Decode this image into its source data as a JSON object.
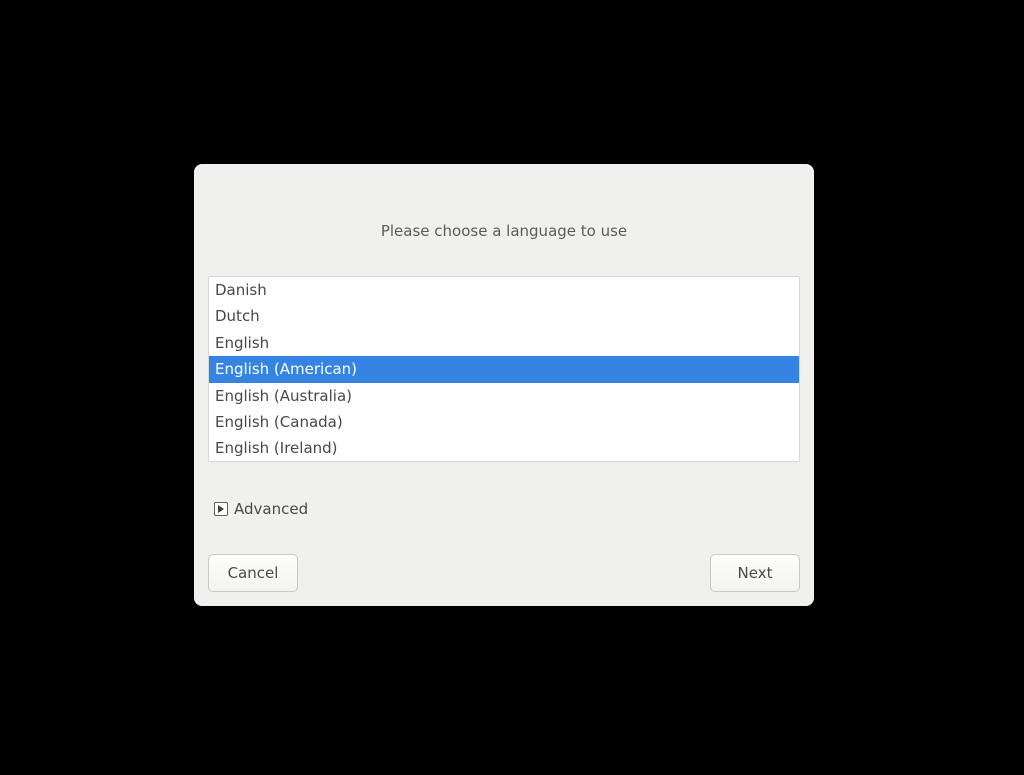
{
  "dialog": {
    "prompt": "Please choose a language to use",
    "languages": [
      {
        "label": "Danish",
        "selected": false
      },
      {
        "label": "Dutch",
        "selected": false
      },
      {
        "label": "English",
        "selected": false
      },
      {
        "label": "English (American)",
        "selected": true
      },
      {
        "label": "English (Australia)",
        "selected": false
      },
      {
        "label": "English (Canada)",
        "selected": false
      },
      {
        "label": "English (Ireland)",
        "selected": false
      }
    ],
    "advanced_label": "Advanced",
    "cancel_label": "Cancel",
    "next_label": "Next"
  },
  "colors": {
    "selection": "#3584e4",
    "dialog_bg": "#f0f0ee"
  }
}
